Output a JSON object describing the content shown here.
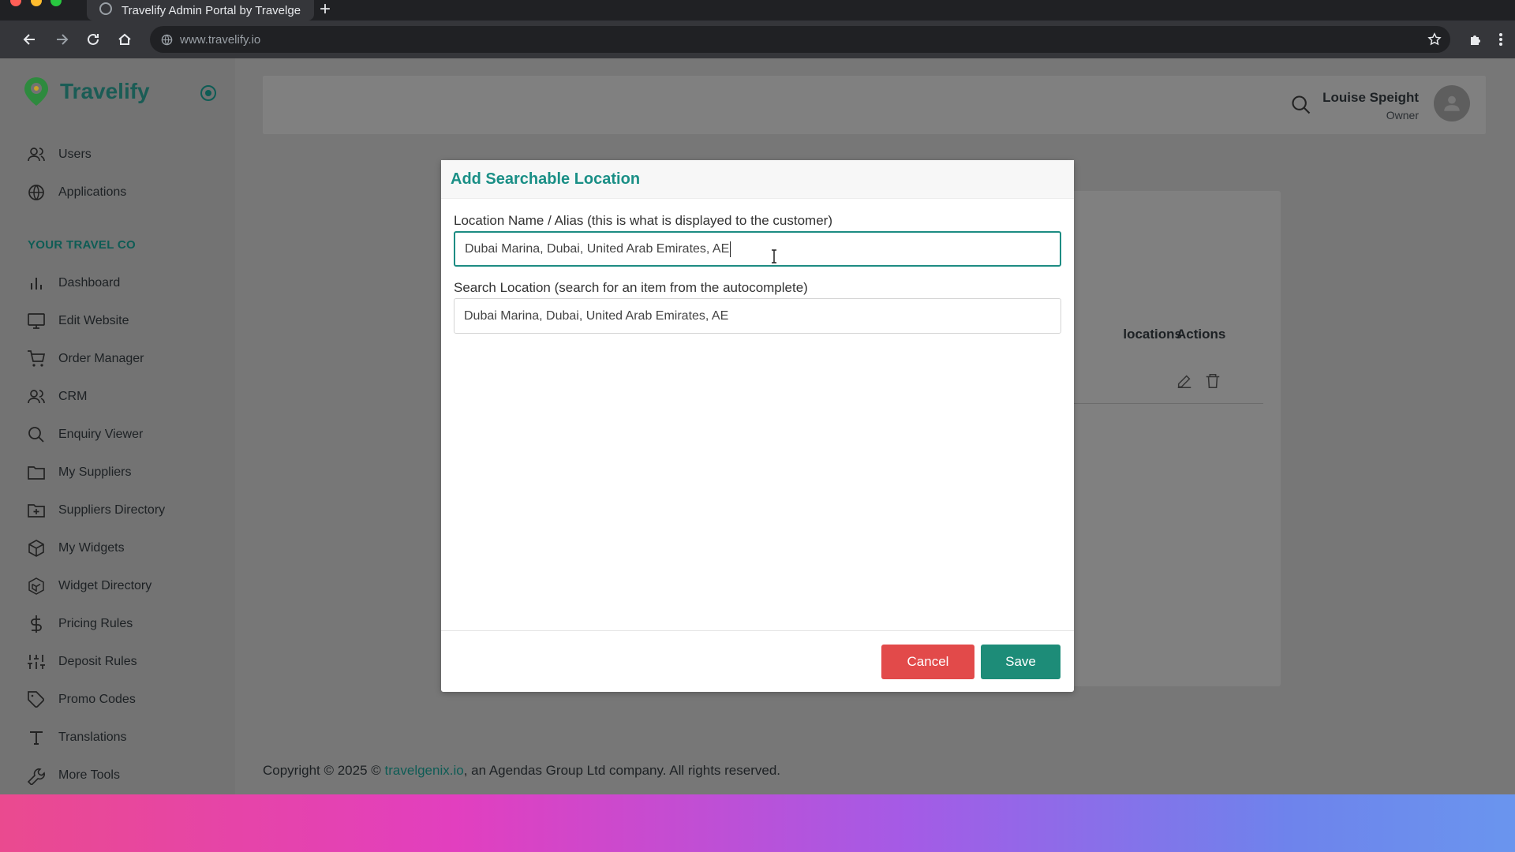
{
  "browser": {
    "tab_title": "Travelify Admin Portal by Travelge",
    "url": "www.travelify.io"
  },
  "brand": {
    "name": "Travelify"
  },
  "sidebar": {
    "top_items": [
      {
        "label": "Users",
        "icon": "users-icon"
      },
      {
        "label": "Applications",
        "icon": "globe-icon"
      }
    ],
    "section_title": "YOUR TRAVEL CO",
    "items": [
      {
        "label": "Dashboard",
        "icon": "bar-chart-icon"
      },
      {
        "label": "Edit Website",
        "icon": "monitor-icon"
      },
      {
        "label": "Order Manager",
        "icon": "cart-icon"
      },
      {
        "label": "CRM",
        "icon": "users-icon"
      },
      {
        "label": "Enquiry Viewer",
        "icon": "search-icon"
      },
      {
        "label": "My Suppliers",
        "icon": "folder-icon"
      },
      {
        "label": "Suppliers Directory",
        "icon": "folder-plus-icon"
      },
      {
        "label": "My Widgets",
        "icon": "box-icon"
      },
      {
        "label": "Widget Directory",
        "icon": "boxes-icon"
      },
      {
        "label": "Pricing Rules",
        "icon": "dollar-icon"
      },
      {
        "label": "Deposit Rules",
        "icon": "sliders-icon"
      },
      {
        "label": "Promo Codes",
        "icon": "tag-icon"
      },
      {
        "label": "Translations",
        "icon": "type-icon"
      },
      {
        "label": "More Tools",
        "icon": "wrench-icon"
      }
    ]
  },
  "header": {
    "user_name": "Louise Speight",
    "user_role": "Owner"
  },
  "background_table": {
    "col_locations": "locations",
    "col_actions": "Actions"
  },
  "footer": {
    "prefix": "Copyright © 2025 © ",
    "link": "travelgenix.io",
    "suffix": ", an Agendas Group Ltd company. All rights reserved."
  },
  "modal": {
    "title": "Add Searchable Location",
    "name_label": "Location Name / Alias (this is what is displayed to the customer)",
    "name_value": "Dubai Marina, Dubai, United Arab Emirates, AE",
    "search_label": "Search Location (search for an item from the autocomplete)",
    "search_value": "Dubai Marina, Dubai, United Arab Emirates, AE",
    "cancel_label": "Cancel",
    "save_label": "Save"
  },
  "colors": {
    "accent": "#1d8c83",
    "cancel": "#e24a4a",
    "save": "#1d8c78"
  }
}
